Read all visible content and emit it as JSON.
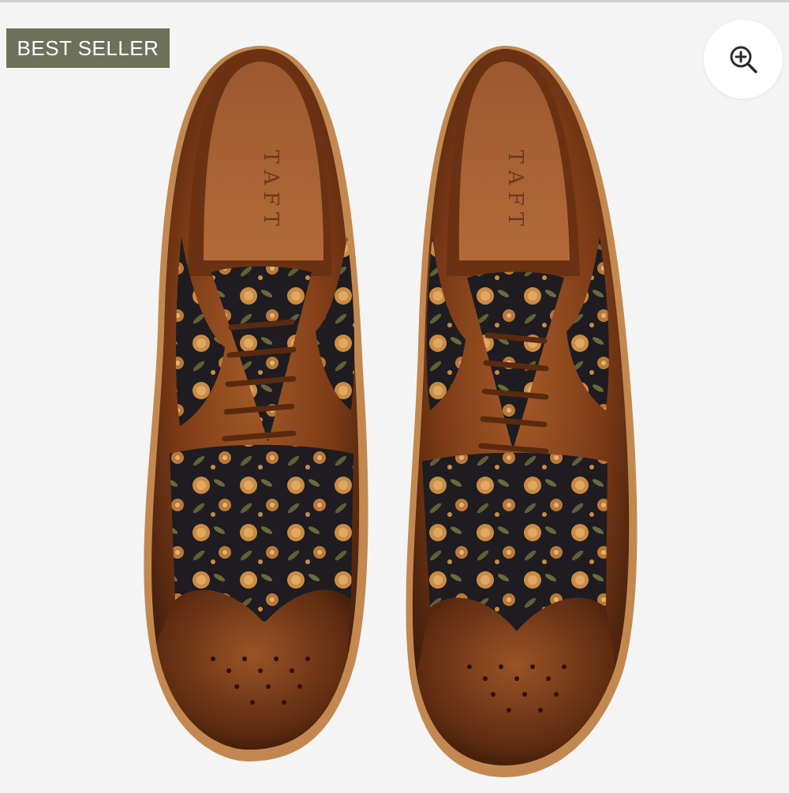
{
  "badge": {
    "label": "BEST SELLER"
  },
  "product": {
    "image_alt": "Brown wingtip brogue oxford shoes with floral jacquard panels, top view",
    "insole_brand": "TAFT"
  },
  "zoom": {
    "icon": "zoom-in-icon",
    "label": "Zoom"
  },
  "colors": {
    "badge_bg": "#6e7159",
    "background": "#f4f4f4",
    "leather": "#7a3a16",
    "sole": "#c28850"
  }
}
